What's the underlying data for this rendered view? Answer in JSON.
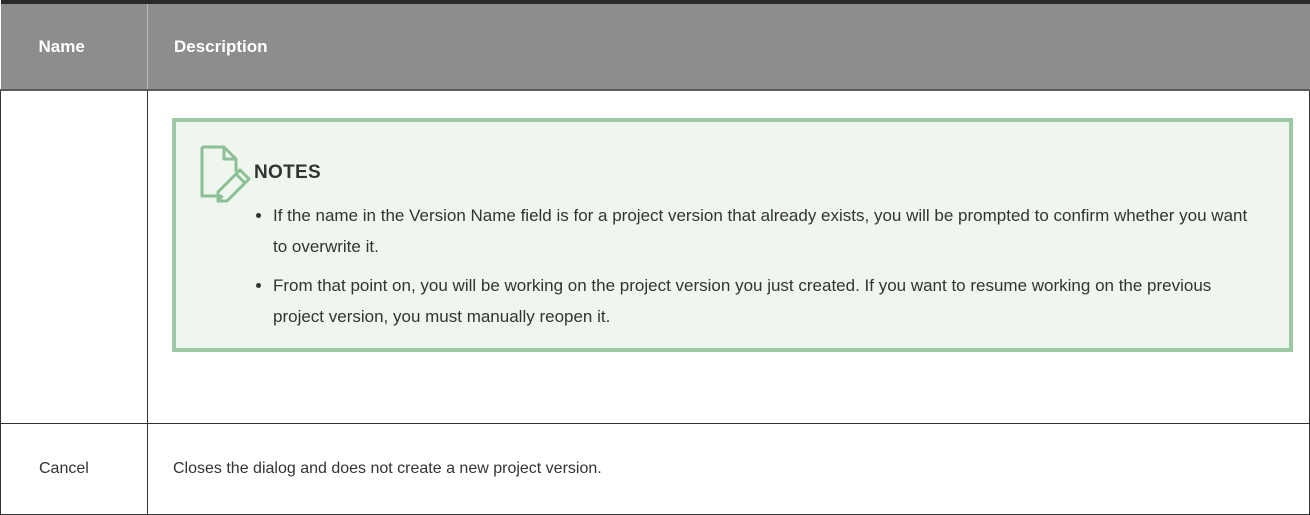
{
  "table": {
    "headers": {
      "name": "Name",
      "description": "Description"
    },
    "rows": [
      {
        "name": "",
        "notes": {
          "title": "NOTES",
          "icon": "note-pencil-icon",
          "items": [
            "If the name in the Version Name field is for a project version that already exists, you will be prompted to confirm whether you want to overwrite it.",
            "From that point on, you will be working on the project version you just created. If you want to resume working on the previous project version, you must manually reopen it."
          ]
        }
      },
      {
        "name": "Cancel",
        "description": "Closes the dialog and does not create a new project version."
      }
    ]
  },
  "colors": {
    "header_bg": "#8c8d8f",
    "note_bg": "#eef6ee",
    "note_border": "#9cc9a3",
    "note_icon": "#8cbf95"
  }
}
